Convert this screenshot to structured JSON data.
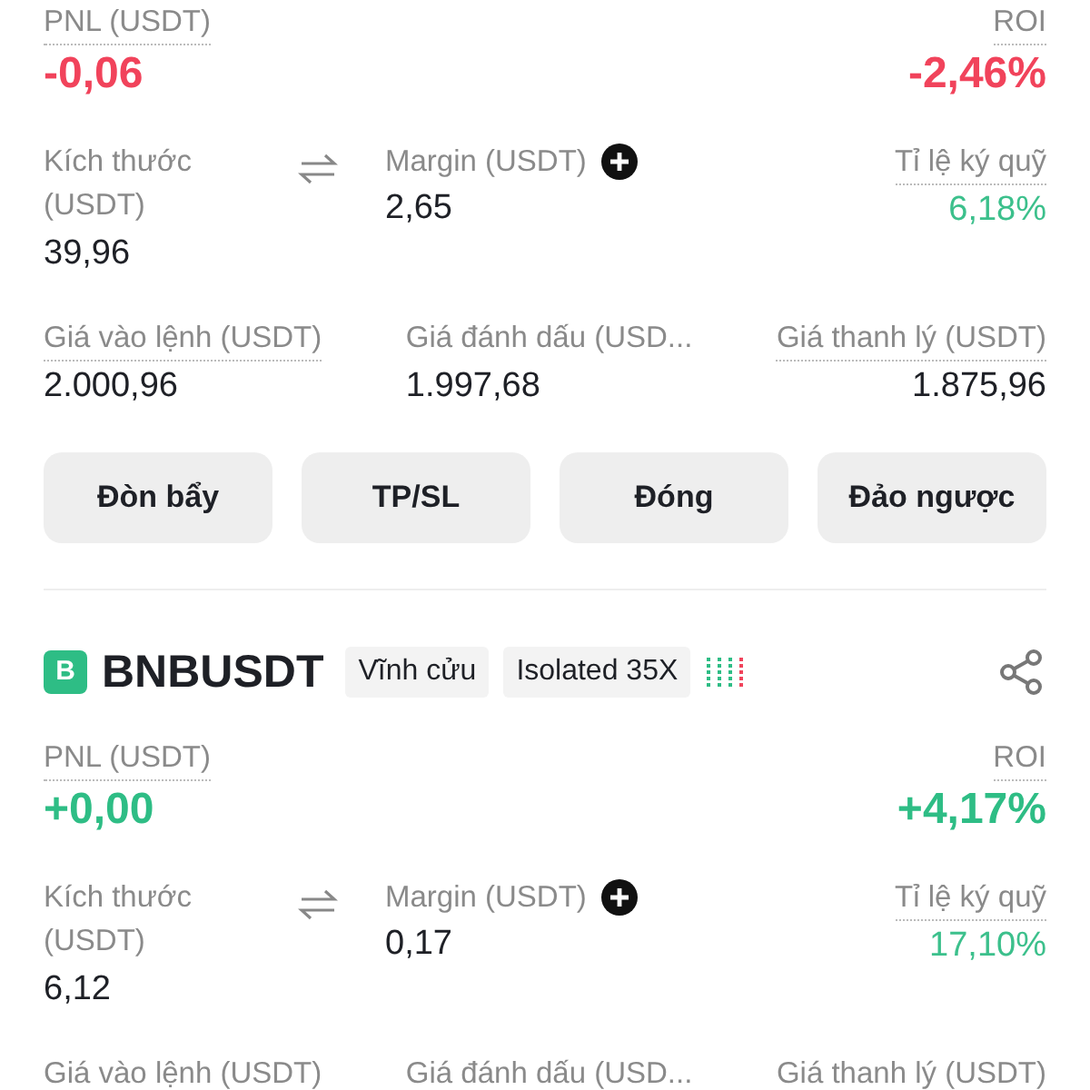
{
  "positions": [
    {
      "pnl": {
        "label": "PNL (USDT)",
        "value": "-0,06",
        "negative": true
      },
      "roi": {
        "label": "ROI",
        "value": "-2,46%",
        "negative": true
      },
      "size": {
        "label": "Kích thước (USDT)",
        "value": "39,96"
      },
      "margin": {
        "label": "Margin (USDT)",
        "value": "2,65"
      },
      "ratio": {
        "label": "Tỉ lệ ký quỹ",
        "value": "6,18%"
      },
      "prices": [
        {
          "label": "Giá vào lệnh (USDT)",
          "value": "2.000,96",
          "dotted": true
        },
        {
          "label": "Giá đánh dấu (USD...",
          "value": "1.997,68",
          "dotted": false
        },
        {
          "label": "Giá thanh lý (USDT)",
          "value": "1.875,96",
          "dotted": true
        }
      ],
      "buttons": [
        "Đòn bẩy",
        "TP/SL",
        "Đóng",
        "Đảo ngược"
      ]
    },
    {
      "header": {
        "badge": "B",
        "symbol": "BNBUSDT",
        "tags": [
          "Vĩnh cửu",
          "Isolated 35X"
        ]
      },
      "pnl": {
        "label": "PNL (USDT)",
        "value": "+0,00",
        "negative": false
      },
      "roi": {
        "label": "ROI",
        "value": "+4,17%",
        "negative": false
      },
      "size": {
        "label": "Kích thước (USDT)",
        "value": "6,12"
      },
      "margin": {
        "label": "Margin (USDT)",
        "value": "0,17"
      },
      "ratio": {
        "label": "Tỉ lệ ký quỹ",
        "value": "17,10%"
      },
      "prices": [
        {
          "label": "Giá vào lệnh (USDT)"
        },
        {
          "label": "Giá đánh dấu (USD..."
        },
        {
          "label": "Giá thanh lý (USDT)"
        }
      ]
    }
  ]
}
